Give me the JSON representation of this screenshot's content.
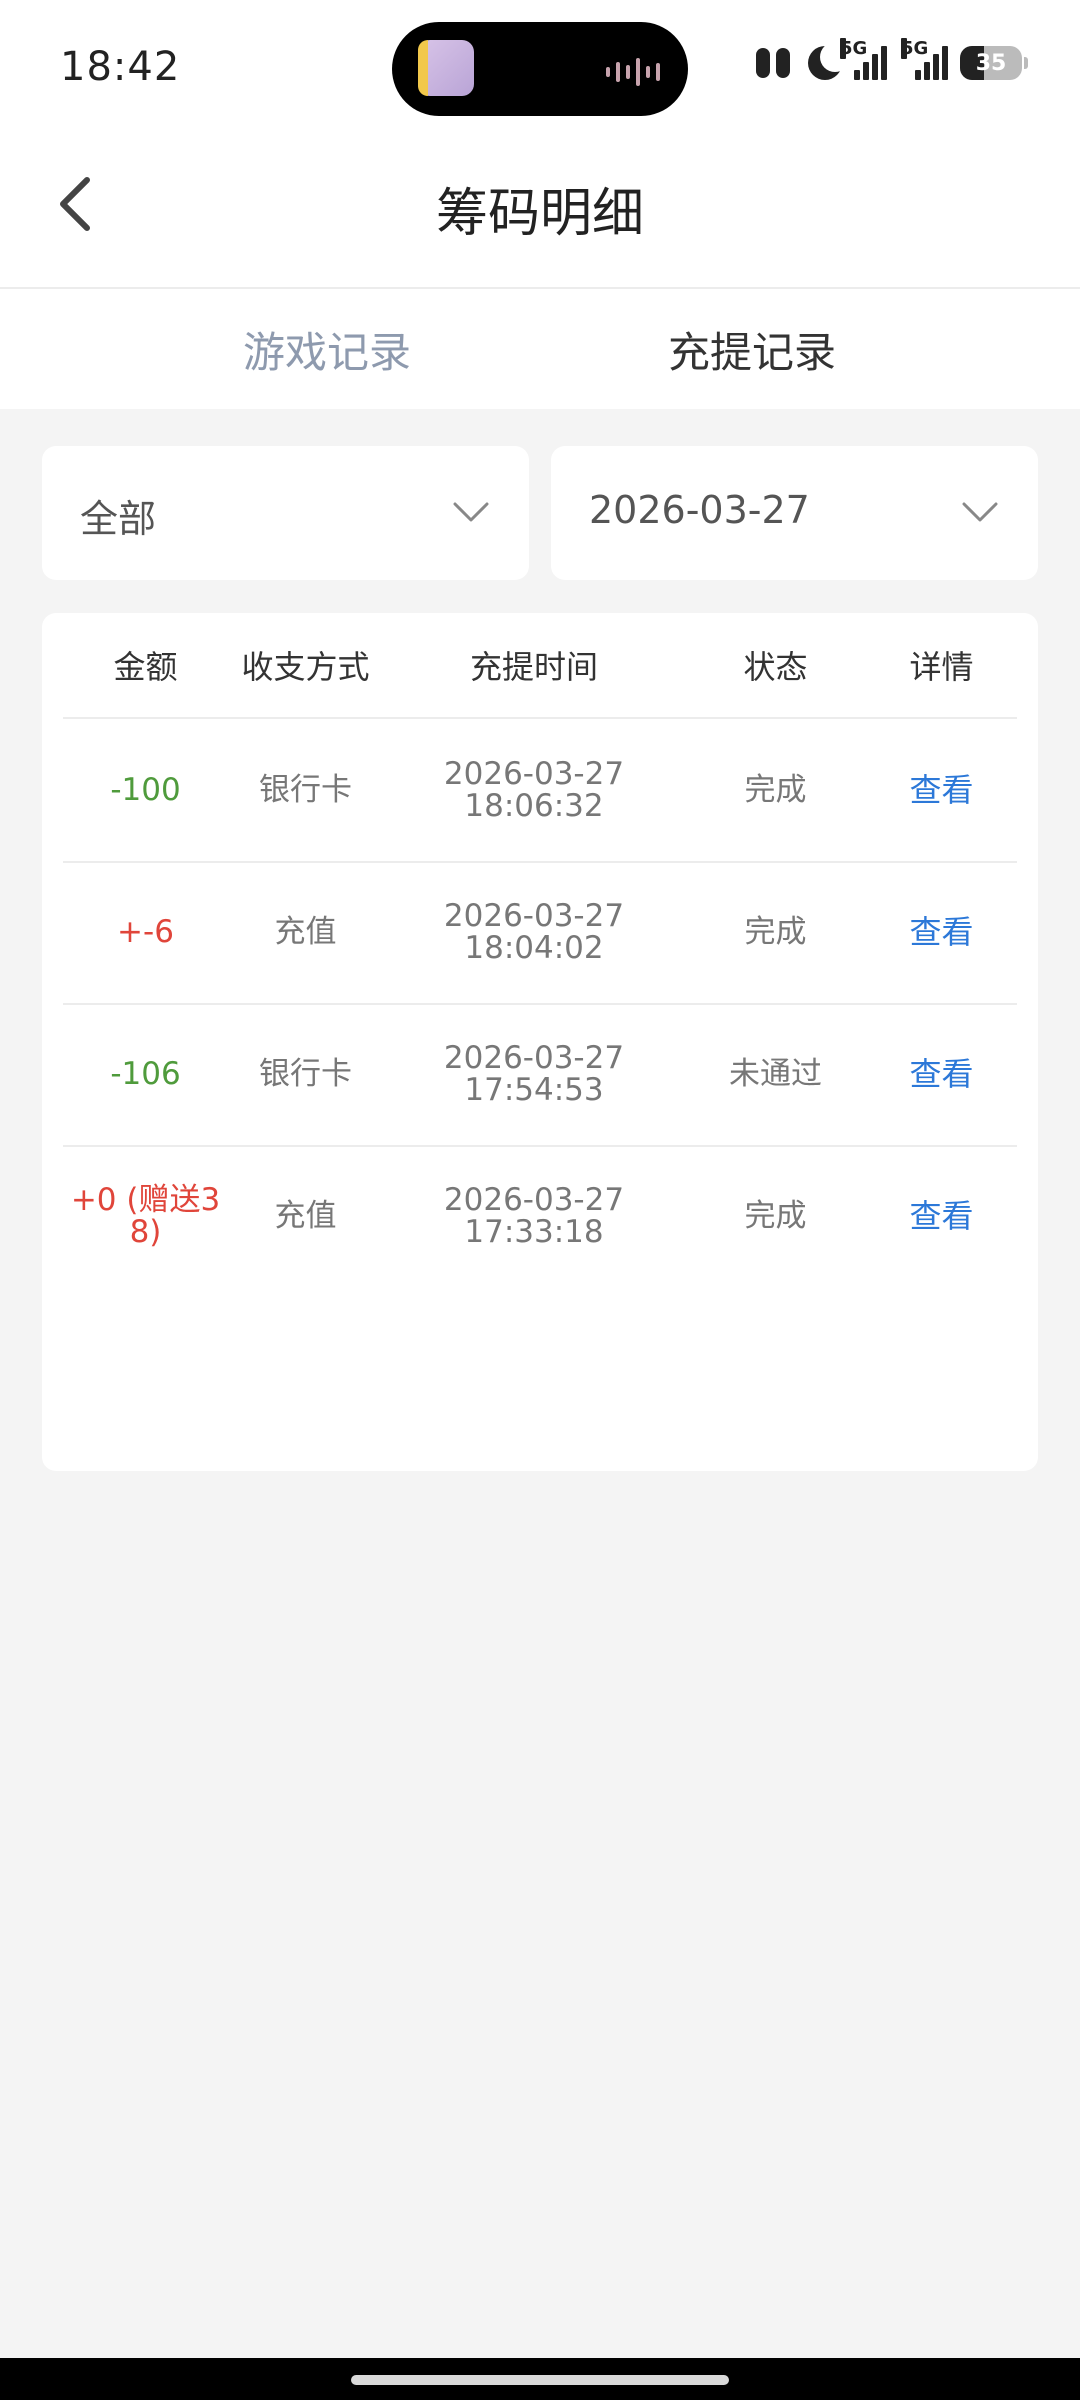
{
  "status_bar": {
    "time": "18:42",
    "network_label": "5G",
    "battery_level": "35"
  },
  "header": {
    "title": "筹码明细"
  },
  "tabs": [
    {
      "label": "游戏记录",
      "active": false
    },
    {
      "label": "充提记录",
      "active": true
    }
  ],
  "filters": {
    "type_value": "全部",
    "date_value": "2026-03-27"
  },
  "table": {
    "columns": [
      "金额",
      "收支方式",
      "充提时间",
      "状态",
      "详情"
    ],
    "rows": [
      {
        "amount": "-100",
        "method": "银行卡",
        "date": "2026-03-27",
        "time": "18:06:32",
        "status": "完成",
        "detail": "查看"
      },
      {
        "amount": "+-6",
        "method": "充值",
        "date": "2026-03-27",
        "time": "18:04:02",
        "status": "完成",
        "detail": "查看"
      },
      {
        "amount": "-106",
        "method": "银行卡",
        "date": "2026-03-27",
        "time": "17:54:53",
        "status": "未通过",
        "detail": "查看"
      },
      {
        "amount_line1": "+0 (赠送3",
        "amount_line2": "8)",
        "method": "充值",
        "date": "2026-03-27",
        "time": "17:33:18",
        "status": "完成",
        "detail": "查看"
      }
    ]
  },
  "colors": {
    "negative_amount": "#4f9b3c",
    "positive_amount": "#e0453a",
    "link": "#2c78d8",
    "inactive_tab": "#8e9aae"
  }
}
